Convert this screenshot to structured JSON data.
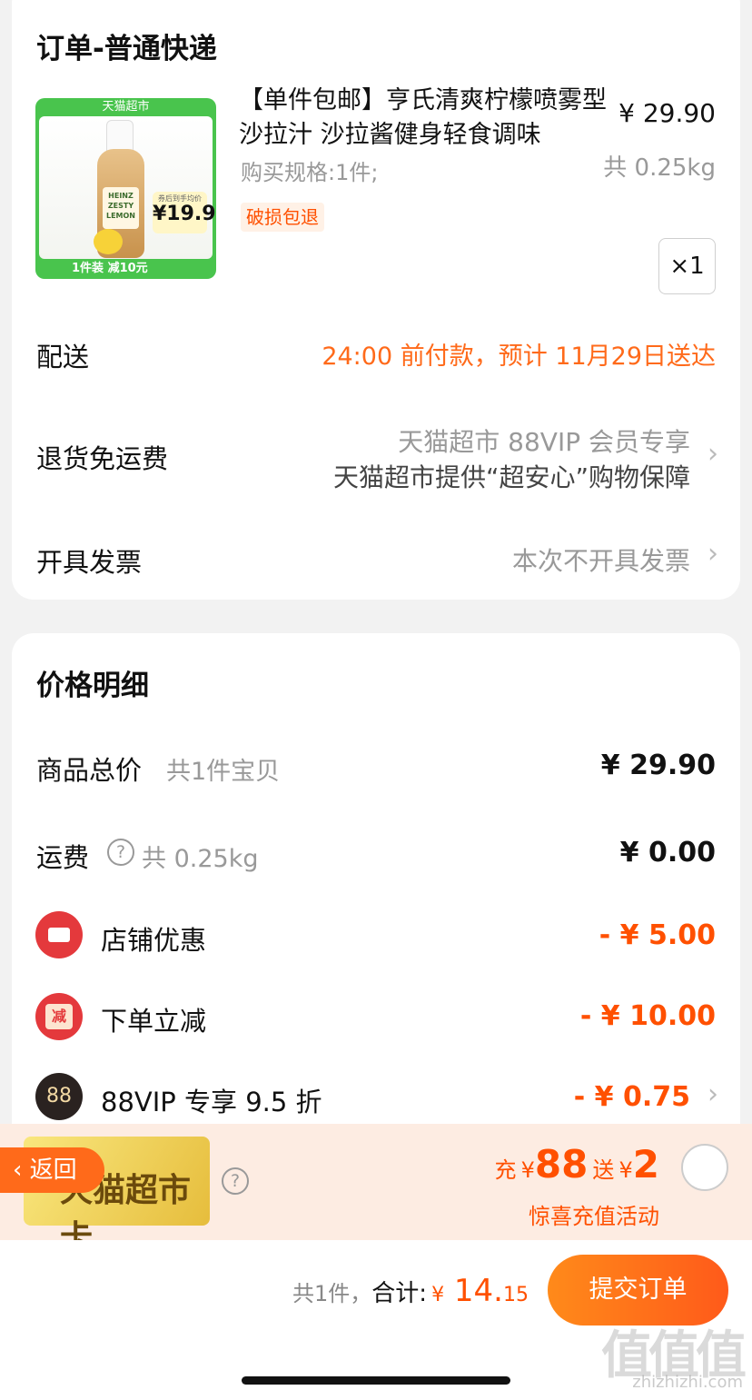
{
  "order_card": {
    "title": "订单-普通快递",
    "product": {
      "image_tag_top": "天猫超市",
      "image_tag_bottom": "1件装 减10元",
      "image_badge_small": "券后到手均价",
      "image_badge_price": "¥19.9",
      "bottle_label": "HEINZ ZESTY LEMON",
      "title": "【单件包邮】亨氏清爽柠檬喷雾型沙拉汁 沙拉酱健身轻食调味",
      "spec": "购买规格:1件;",
      "badge": "破损包退",
      "price": "¥ 29.90",
      "weight": "共 0.25kg",
      "quantity": "×1"
    },
    "delivery": {
      "label": "配送",
      "value": "24:00 前付款，预计 11月29日送达"
    },
    "return_shipping": {
      "label": "退货免运费",
      "line1": "天猫超市 88VIP 会员专享",
      "line2": "天猫超市提供“超安心”购物保障"
    },
    "invoice": {
      "label": "开具发票",
      "value": "本次不开具发票"
    }
  },
  "price_detail": {
    "title": "价格明细",
    "rows": [
      {
        "label": "商品总价",
        "sub": "共1件宝贝",
        "amount": "¥ 29.90"
      },
      {
        "label": "运费",
        "help": "?",
        "sub": "共 0.25kg",
        "amount": "¥ 0.00"
      },
      {
        "label": "店铺优惠",
        "icon": "ticket-icon",
        "amount": "- ¥ 5.00"
      },
      {
        "label": "下单立减",
        "icon_text": "减",
        "amount": "- ¥ 10.00"
      },
      {
        "label": "88VIP 专享 9.5 折",
        "icon_text": "88",
        "amount": "- ¥ 0.75"
      }
    ]
  },
  "promo": {
    "card_text": "天猫超市卡",
    "back_label": "返回",
    "help": "?",
    "charge_label": "充",
    "charge_currency": "¥",
    "charge_amount": "88",
    "gift_label": "送",
    "gift_currency": "¥",
    "gift_amount": "2",
    "subtitle": "惊喜充值活动"
  },
  "footer": {
    "count": "共1件，",
    "total_label": "合计:",
    "currency": "¥",
    "total_int": " 14.",
    "total_dec": "15",
    "submit": "提交订单",
    "watermark": "值值值",
    "watermark_url": "zhizhizhi.com"
  },
  "colors": {
    "accent": "#ff5000",
    "orange_text": "#ff6a1a",
    "grey_text": "#999999",
    "green_tag": "#49c44d",
    "red_icon": "#e4393c"
  }
}
